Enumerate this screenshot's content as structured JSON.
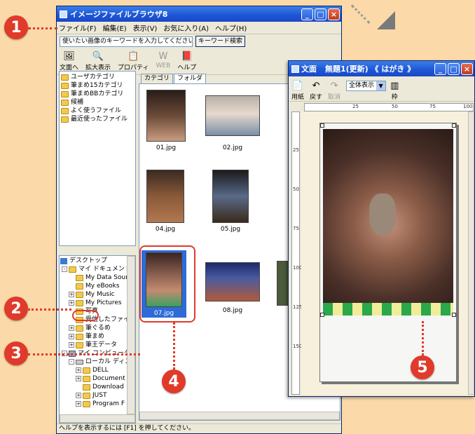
{
  "callouts": [
    "1",
    "2",
    "3",
    "4",
    "5"
  ],
  "browser": {
    "title": "イメージファイルブラウザ8",
    "menu": [
      "ファイル(F)",
      "編集(E)",
      "表示(V)",
      "お気に入り(A)",
      "ヘルプ(H)"
    ],
    "search_placeholder": "使いたい画像のキーワードを入力してください",
    "search_button": "キーワード検索",
    "toolbar": [
      "文面へ",
      "拡大表示",
      "プロパティ",
      "WEB",
      "ヘルプ"
    ],
    "categories": [
      "ユーザカテゴリ",
      "筆まめ15カテゴリ",
      "筆まめBBカテゴリ",
      "候補",
      "よく使うファイル",
      "最近使ったファイル"
    ],
    "folder_tree": [
      "デスクトップ",
      "マイ ドキュメント",
      "My Data Sour",
      "My eBooks",
      "My Music",
      "My Pictures",
      "写真",
      "受信したファイ",
      "筆ぐるめ",
      "筆まめ",
      "筆王データ",
      "マイ コンピュータ",
      "ローカル ディス",
      "DELL",
      "Document",
      "Download",
      "JUST",
      "Program F"
    ],
    "tabs": [
      "カテゴリ",
      "フォルダ"
    ],
    "thumbnails": [
      "01.jpg",
      "02.jpg",
      "04.jpg",
      "05.jpg",
      "07.jpg",
      "08.jpg"
    ],
    "status": "ヘルプを表示するには [F1] を押してください。"
  },
  "editor": {
    "title_app": "文面",
    "title_doc": "無題1(更新) 《 はがき 》",
    "toolbar": [
      "用紙",
      "戻す",
      "取消",
      "枠"
    ],
    "zoom": "全体表示",
    "ruler_top": [
      "25",
      "50",
      "75",
      "100"
    ],
    "ruler_left": [
      "25",
      "50",
      "75",
      "100",
      "125",
      "150"
    ]
  },
  "colors": {
    "accent": "#e03a2a",
    "background": "#fbd9a8",
    "titlebar": "#1c55d6"
  }
}
